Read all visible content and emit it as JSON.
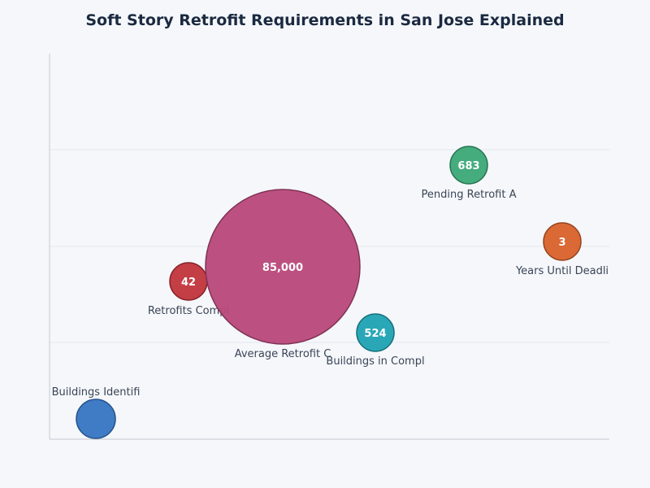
{
  "chart_data": {
    "type": "scatter",
    "title": "Soft Story Retrofit Requirements in San Jose Explained",
    "xlabel": "",
    "ylabel": "",
    "grid": true,
    "points": [
      {
        "label": "Buildings Identifi",
        "value_label": "",
        "color": "#3575c2"
      },
      {
        "label": "Retrofits Compl",
        "value_label": "42",
        "color": "#c0343b"
      },
      {
        "label": "Average Retrofit C",
        "value_label": "85,000",
        "color": "#b8487a"
      },
      {
        "label": "Buildings in Compl",
        "value_label": "524",
        "color": "#1fa2b3"
      },
      {
        "label": "Pending Retrofit A",
        "value_label": "683",
        "color": "#3ba877"
      },
      {
        "label": "Years Until Deadli",
        "value_label": "3",
        "color": "#d8612a"
      }
    ]
  }
}
